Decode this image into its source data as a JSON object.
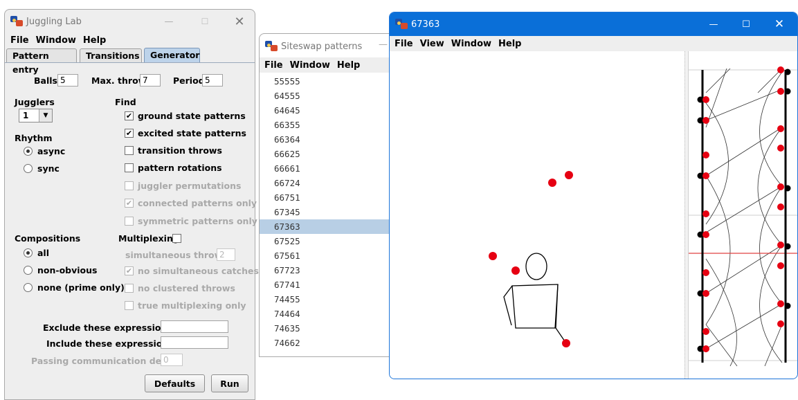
{
  "jlab": {
    "title": "Juggling Lab",
    "menu": [
      "File",
      "Window",
      "Help"
    ],
    "tabs": [
      "Pattern entry",
      "Transitions",
      "Generator"
    ],
    "active_tab": "Generator",
    "balls_label": "Balls",
    "balls_value": "5",
    "maxthrow_label": "Max. throw",
    "maxthrow_value": "7",
    "period_label": "Period",
    "period_value": "5",
    "jugglers_label": "Jugglers",
    "jugglers_value": "1",
    "find_label": "Find",
    "find_options": [
      {
        "label": "ground state patterns",
        "checked": true,
        "enabled": true
      },
      {
        "label": "excited state patterns",
        "checked": true,
        "enabled": true
      },
      {
        "label": "transition throws",
        "checked": false,
        "enabled": true
      },
      {
        "label": "pattern rotations",
        "checked": false,
        "enabled": true
      },
      {
        "label": "juggler permutations",
        "checked": false,
        "enabled": false
      },
      {
        "label": "connected patterns only",
        "checked": true,
        "enabled": false
      },
      {
        "label": "symmetric patterns only",
        "checked": false,
        "enabled": false
      }
    ],
    "rhythm_label": "Rhythm",
    "rhythm_options": [
      {
        "label": "async",
        "selected": true
      },
      {
        "label": "sync",
        "selected": false
      }
    ],
    "compositions_label": "Compositions",
    "composition_options": [
      {
        "label": "all",
        "selected": true
      },
      {
        "label": "non-obvious",
        "selected": false
      },
      {
        "label": "none (prime only)",
        "selected": false
      }
    ],
    "multiplexing_label": "Multiplexing",
    "multiplexing_checked": false,
    "simultaneous_label": "simultaneous throws",
    "simultaneous_value": "2",
    "mux_options": [
      {
        "label": "no simultaneous catches",
        "checked": true
      },
      {
        "label": "no clustered throws",
        "checked": false
      },
      {
        "label": "true multiplexing only",
        "checked": false
      }
    ],
    "exclude_label": "Exclude these expressions",
    "exclude_value": "",
    "include_label": "Include these expressions",
    "include_value": "",
    "delay_label": "Passing communication delay",
    "delay_value": "0",
    "defaults_button": "Defaults",
    "run_button": "Run"
  },
  "siteswap": {
    "title": "Siteswap patterns",
    "menu": [
      "File",
      "Window",
      "Help"
    ],
    "patterns": [
      "55555",
      "64555",
      "64645",
      "66355",
      "66364",
      "66625",
      "66661",
      "66724",
      "66751",
      "67345",
      "67363",
      "67525",
      "67561",
      "67723",
      "67741",
      "74455",
      "74464",
      "74635",
      "74662"
    ],
    "selected": "67363"
  },
  "anim": {
    "title": "67363",
    "menu": [
      "File",
      "View",
      "Window",
      "Help"
    ],
    "ball_color": "#e60012",
    "titlebar_color": "#0a6fd8"
  }
}
